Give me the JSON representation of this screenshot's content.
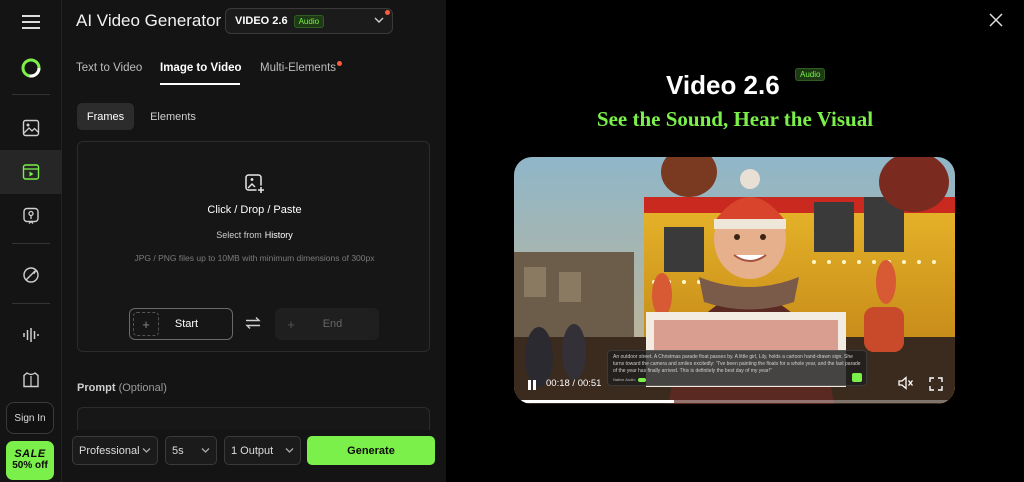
{
  "rail": {
    "signin": "Sign In",
    "sale_title": "SALE",
    "sale_sub": "50% off"
  },
  "generator": {
    "title": "AI Video Generator",
    "model": {
      "name": "VIDEO 2.6",
      "badge": "Audio"
    },
    "tabs": [
      {
        "label": "Text to Video",
        "active": false
      },
      {
        "label": "Image to Video",
        "active": true
      },
      {
        "label": "Multi-Elements",
        "active": false
      }
    ],
    "subtabs": [
      {
        "label": "Frames",
        "active": true
      },
      {
        "label": "Elements",
        "active": false
      }
    ],
    "upload": {
      "main": "Click / Drop / Paste",
      "select_prefix": "Select from",
      "select_link": "History",
      "hint": "JPG / PNG files up to 10MB with minimum dimensions of 300px",
      "start_label": "Start",
      "end_label": "End"
    },
    "prompt": {
      "label": "Prompt",
      "optional": "(Optional)"
    },
    "controls": {
      "mode": "Professional",
      "duration": "5s",
      "outputs": "1 Output",
      "generate": "Generate"
    }
  },
  "promo": {
    "title": "Video 2.6",
    "badge": "Audio",
    "subtitle": "See the Sound, Hear the Visual",
    "caption": "An outdoor street. A Christmas parade float passes by. A little girl, Lily, holds a cartoon hand-drawn sign. She turns toward the camera and smiles excitedly: \"I've been painting the floats for a whole year, and the last parade of the year has finally arrived. This is definitely the best day of my year!\"",
    "caption_toggle": "Native Audio",
    "time": "00:18 / 00:51",
    "progress": 0.36
  }
}
